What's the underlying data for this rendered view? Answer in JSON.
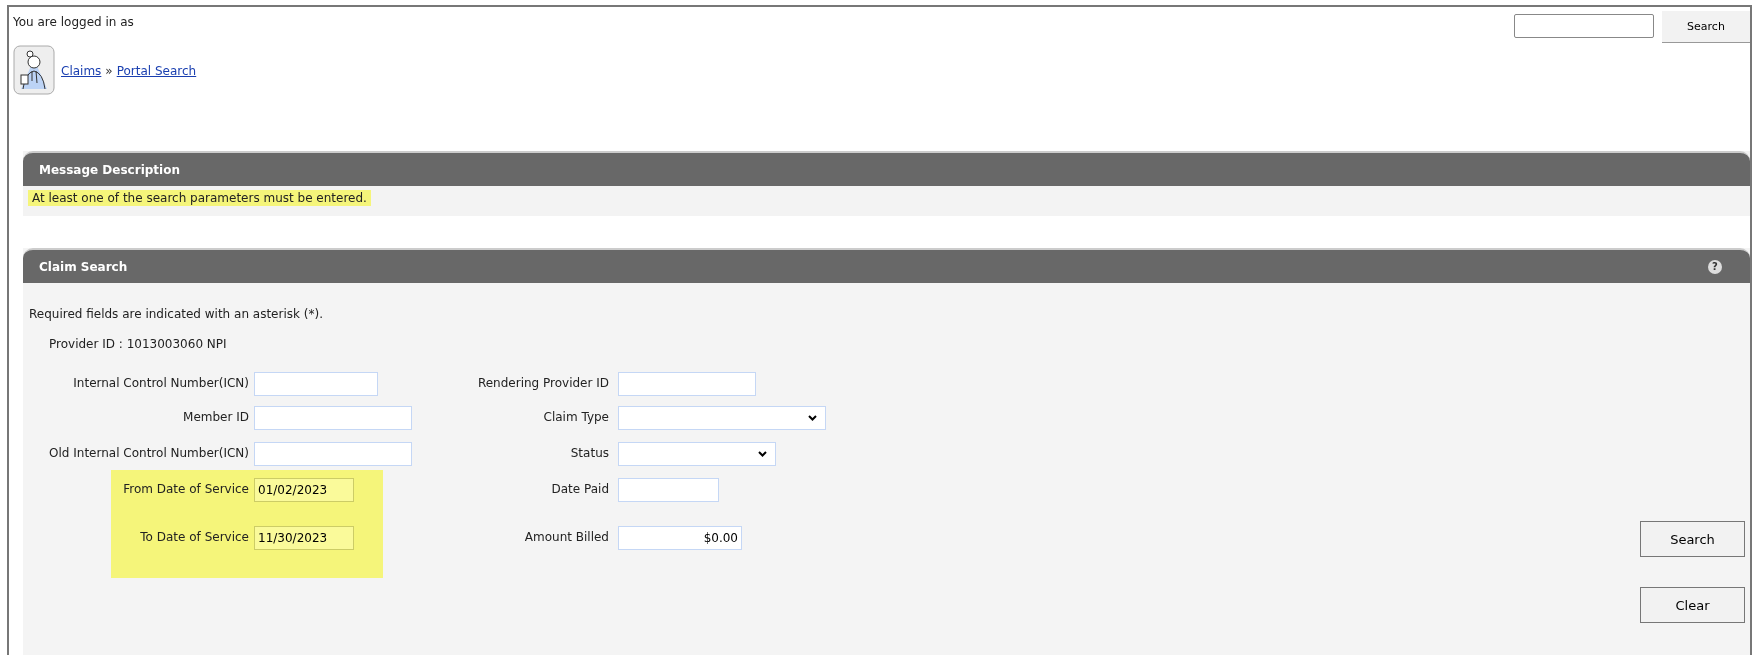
{
  "header": {
    "login_text": "You are logged in as",
    "search": {
      "button": "Search"
    }
  },
  "breadcrumbs": [
    {
      "label": "Claims"
    },
    {
      "label": "Portal Search"
    }
  ],
  "breadcrumb_separator": "»",
  "message_panel": {
    "title": "Message Description",
    "message": "At least one of the search parameters must be entered.",
    "highlighted": true
  },
  "claim_search": {
    "title": "Claim Search",
    "help": "?",
    "note": "Required fields are indicated with an asterisk (*).",
    "provider_id": "Provider ID : 1013003060 NPI",
    "left_fields": [
      {
        "label": "Internal Control Number(ICN)",
        "highlighted": false
      },
      {
        "label": "Member ID",
        "highlighted": false
      },
      {
        "label": "Old Internal Control Number(ICN)",
        "highlighted": false
      },
      {
        "label": "From Date of Service",
        "value": "01/02/2023",
        "highlighted": true
      },
      {
        "label": "To Date of Service",
        "value": "11/30/2023",
        "highlighted": true
      }
    ],
    "right_fields": [
      {
        "label": "Rendering Provider ID",
        "kind": "text"
      },
      {
        "label": "Claim Type",
        "kind": "select"
      },
      {
        "label": "Status",
        "kind": "select"
      },
      {
        "label": "Date Paid",
        "kind": "text"
      },
      {
        "label": "Amount Billed",
        "kind": "money",
        "value": "$0.00"
      }
    ],
    "buttons": [
      "Search",
      "Clear"
    ]
  }
}
